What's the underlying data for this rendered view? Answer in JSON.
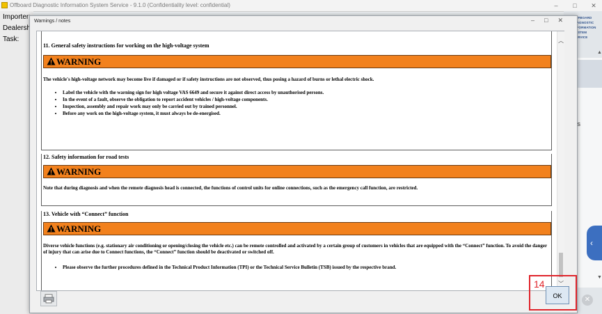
{
  "app": {
    "title": "Offboard Diagnostic Information System Service - 9.1.0 (Confidentiality level: confidential)",
    "win_minimize": "–",
    "win_maximize": "□",
    "win_close": "✕",
    "left_labels": {
      "importer": "Importer:",
      "dealership": "Dealershi",
      "task": "Task:"
    },
    "brand_lines": [
      "OFFBOARD",
      "DIAGNOSTIC",
      "INFORMATION",
      "SYSTEM",
      "SERVICE"
    ],
    "right_texts": {
      "s": "s",
      "nts": "nts"
    }
  },
  "dialog": {
    "title": "Warnings / notes",
    "warning_label": "WARNING",
    "sections": [
      {
        "title": "11. General safety instructions for working on the high-voltage system",
        "text": "The vehicle's high-voltage network may become live if damaged or if safety instructions are not observed, thus posing a hazard of burns or lethal electric shock.",
        "bullets": [
          "Label the vehicle with the warning sign for high voltage VAS 6649 and secure it against direct access by unauthorised persons.",
          "In the event of a fault, observe the obligation to report accident vehicles / high-voltage components.",
          "Inspection, assembly and repair work may only be carried out by trained personnel.",
          "Before any work on the high-voltage system, it must always be de-energised."
        ]
      },
      {
        "title": "12. Safety information for road tests",
        "text": "Note that during diagnosis and when the remote diagnosis head is connected, the functions of control units for online connections, such as the emergency call function, are restricted."
      },
      {
        "title": "13. Vehicle with “Connect” function",
        "text": "Diverse vehicle functions (e.g. stationary air conditioning or opening/closing the vehicle etc.) can be remote controlled and activated by a certain group of customers in vehicles that are equipped with the “Connect” function. To avoid the danger of injury that can arise due to Connect functions, the “Connect” function should be deactivated or switched off.",
        "bullets": [
          "Please observe the further procedures defined in the Technical Product Information (TPI) or the Technical Service Bulletin (TSB) issued by the respective brand."
        ]
      }
    ],
    "ok_label": "OK",
    "annotation_number": "14"
  },
  "colors": {
    "warning_bar": "#f2811d",
    "annotation": "#e0232a",
    "side_tab": "#3c6fc0"
  }
}
